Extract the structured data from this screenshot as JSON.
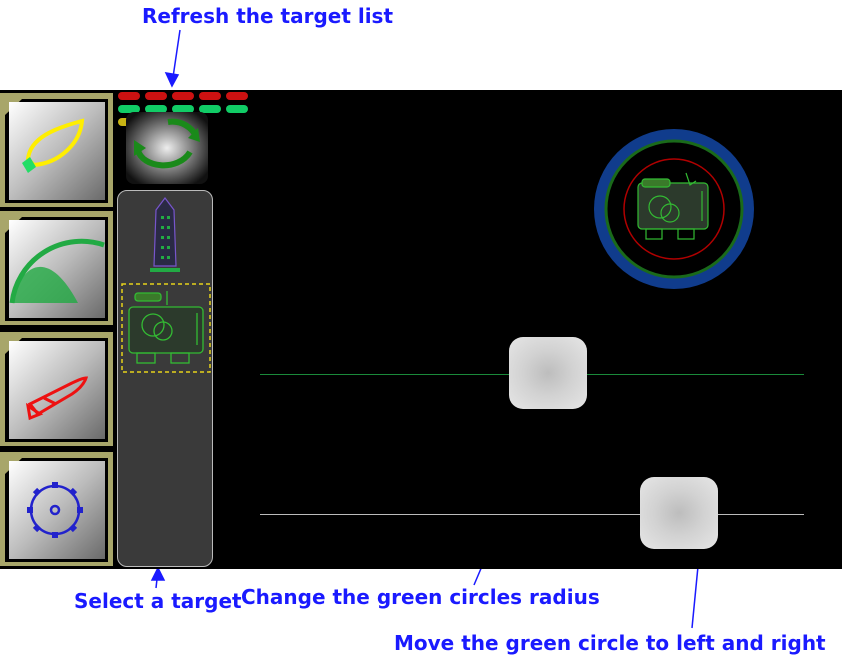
{
  "annotations": {
    "refresh": "Refresh the target list",
    "select": "Select a target",
    "radius": "Change the green circles radius",
    "move": "Move the green circle to left and right"
  },
  "colors": {
    "annotation": "#1a1aff",
    "panel_bg": "#000000",
    "button_frame": "#a8a66a",
    "led_red": "#cc1111",
    "led_green": "#11cc66",
    "led_yellow": "#c8b414",
    "radar_blue": "#103c8c",
    "radar_green": "#1a6a1a",
    "radar_red": "#b00000",
    "track_green": "#1a8a3a",
    "track_white": "#bbbbbb"
  },
  "sidebar": {
    "buttons": [
      {
        "icon": "leaf-icon"
      },
      {
        "icon": "arc-icon"
      },
      {
        "icon": "rocket-icon"
      },
      {
        "icon": "gear-icon"
      }
    ]
  },
  "leds": {
    "rows": [
      [
        "red",
        "red",
        "red",
        "red",
        "red"
      ],
      [
        "green",
        "green",
        "green",
        "green",
        "green"
      ],
      [
        "yellow",
        "yellow"
      ]
    ]
  },
  "targets": [
    {
      "icon": "tower-ship-icon",
      "selected": false
    },
    {
      "icon": "robot-icon",
      "selected": true
    }
  ],
  "sliders": {
    "radius": {
      "value": 0.53
    },
    "position": {
      "value": 0.77
    }
  }
}
